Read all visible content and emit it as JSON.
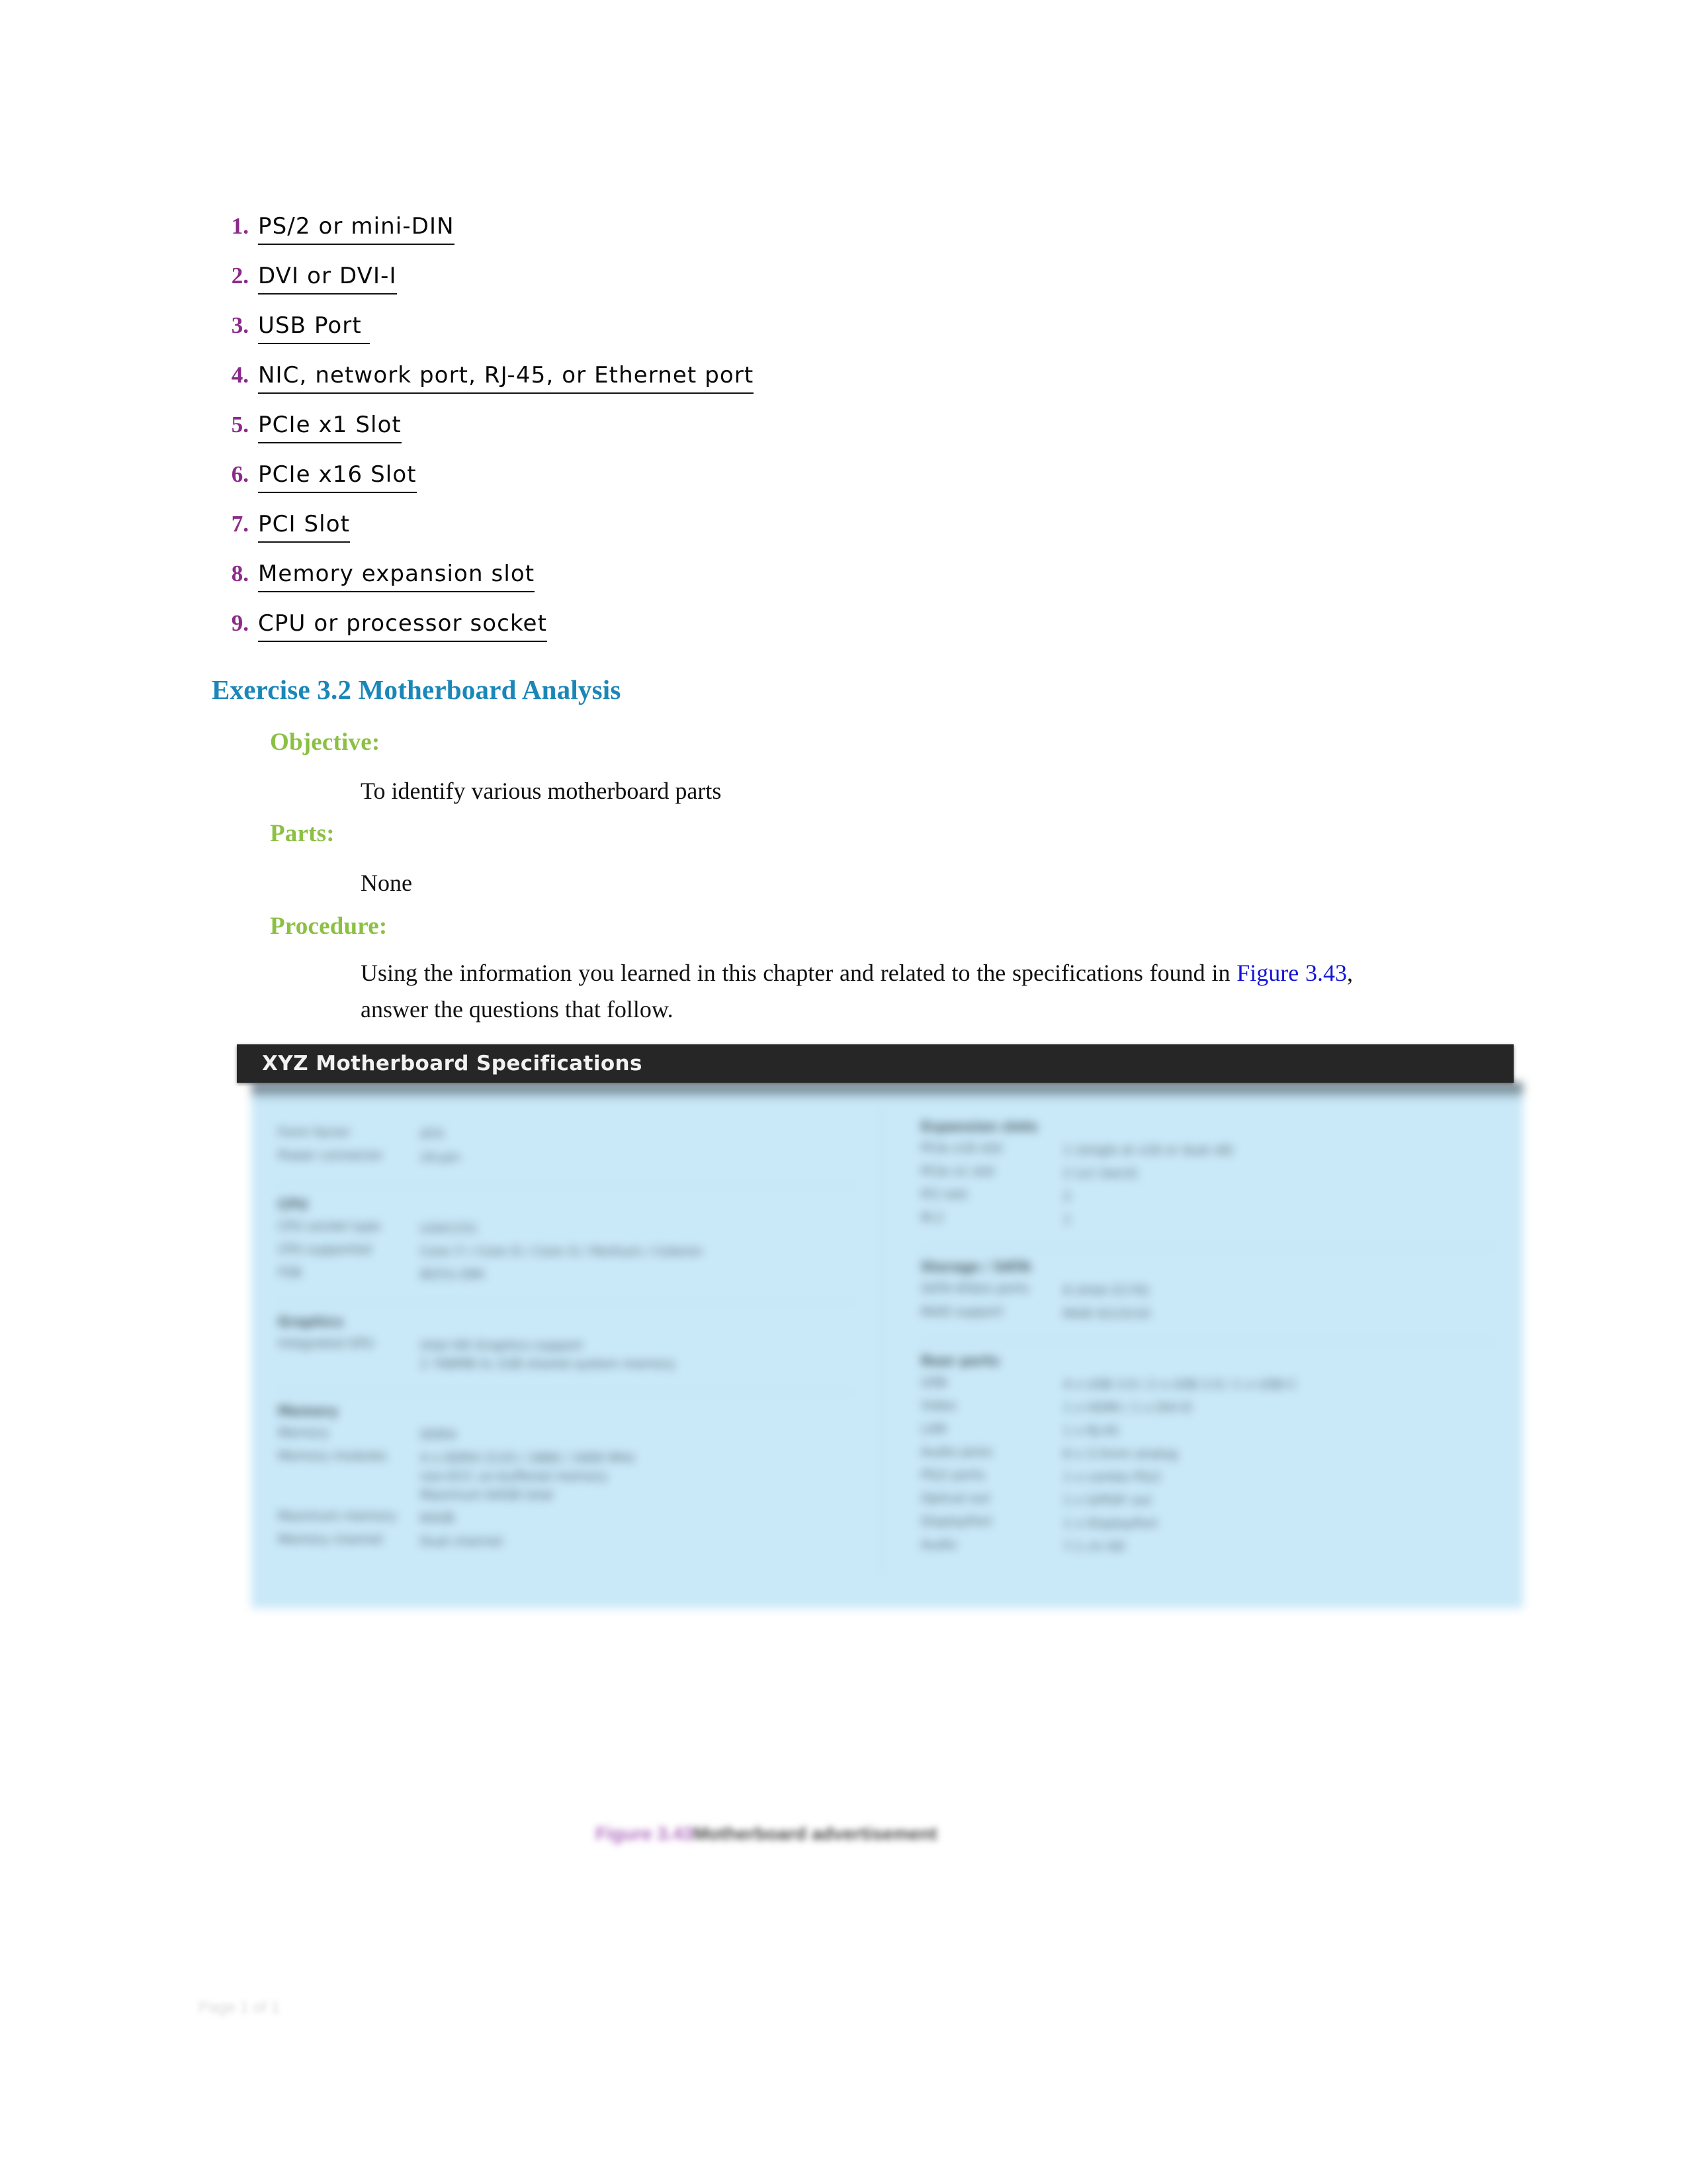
{
  "answer_list": {
    "items": [
      {
        "num": "1.",
        "text": "PS/2 or mini-DIN"
      },
      {
        "num": "2.",
        "text": "DVI or DVI-I"
      },
      {
        "num": "3.",
        "text": "USB Port "
      },
      {
        "num": "4.",
        "text": "NIC, network port, RJ-45, or Ethernet port"
      },
      {
        "num": "5.",
        "text": "PCIe x1 Slot"
      },
      {
        "num": "6.",
        "text": "PCIe x16 Slot"
      },
      {
        "num": "7.",
        "text": "PCI Slot"
      },
      {
        "num": "8.",
        "text": "Memory expansion slot"
      },
      {
        "num": "9.",
        "text": "CPU or processor socket"
      }
    ]
  },
  "exercise": {
    "heading": "Exercise 3.2 Motherboard Analysis",
    "objective_label": "Objective:",
    "objective_text": "To identify various motherboard parts",
    "parts_label": "Parts:",
    "parts_text": "None",
    "procedure_label": "Procedure:",
    "procedure_text_before": "Using the information you learned in this chapter and related to the specifications found in ",
    "procedure_figure_link": "Figure 3.43",
    "procedure_text_after": ", answer the questions that follow."
  },
  "figure": {
    "titlebar": "XYZ Motherboard Specifications",
    "caption_label": "Figure 3.43",
    "caption_text": "Motherboard advertisement",
    "left_column": [
      {
        "title": "",
        "rows": [
          {
            "key": "Form factor",
            "value": "ATX"
          },
          {
            "key": "Power connector",
            "value": "24-pin"
          }
        ]
      },
      {
        "title": "CPU",
        "rows": [
          {
            "key": "CPU socket type",
            "value": "LGA1151"
          },
          {
            "key": "CPU supported",
            "value": "Core i7 / Core i5 / Core i3 / Pentium / Celeron"
          },
          {
            "key": "FSB",
            "value": "8GT/s DMI"
          }
        ]
      },
      {
        "title": "Graphics",
        "rows": [
          {
            "key": "Integrated GPU",
            "value": "Intel HD Graphics support\n2 768MB to 1GB shared system memory"
          }
        ]
      },
      {
        "title": "Memory",
        "rows": [
          {
            "key": "Memory",
            "value": "DDR4"
          },
          {
            "key": "Memory modules",
            "value": "4 x DDR4 2133 / 1866 / 1600 MHz\nnon-ECC un-buffered memory\nMaximum 64GB total"
          },
          {
            "key": "Maximum memory",
            "value": "64GB"
          },
          {
            "key": "Memory channel",
            "value": "Dual channel"
          }
        ]
      }
    ],
    "right_column": [
      {
        "title": "Expansion slots",
        "rows": [
          {
            "key": "PCIe x16 slot",
            "value": "1 (single at x16 or dual x8)"
          },
          {
            "key": "PCIe x1 slot",
            "value": "2 (x1 Gen3)"
          },
          {
            "key": "PCI slot",
            "value": "2"
          },
          {
            "key": "M.2",
            "value": "1"
          }
        ]
      },
      {
        "title": "Storage / SATA",
        "rows": [
          {
            "key": "SATA 6Gb/s ports",
            "value": "6 (Intel Z170)"
          },
          {
            "key": "RAID support",
            "value": "RAID 0/1/5/10"
          }
        ]
      },
      {
        "title": "Rear ports",
        "rows": [
          {
            "key": "USB",
            "value": "4 x USB 3.0 / 2 x USB 2.0 / 1 x USB-C"
          },
          {
            "key": "Video",
            "value": "1 x HDMI / 1 x DVI-D"
          },
          {
            "key": "LAN",
            "value": "1 x RJ-45"
          },
          {
            "key": "Audio jacks",
            "value": "6 x 3.5mm analog"
          },
          {
            "key": "PS/2 ports",
            "value": "1 x combo PS/2"
          },
          {
            "key": "Optical out",
            "value": "1 x S/PDIF out"
          },
          {
            "key": "DisplayPort",
            "value": "1 x DisplayPort"
          },
          {
            "key": "Audio",
            "value": "7.1 ch HD"
          }
        ]
      }
    ]
  },
  "footer": {
    "text": "Page 1 of 1"
  }
}
